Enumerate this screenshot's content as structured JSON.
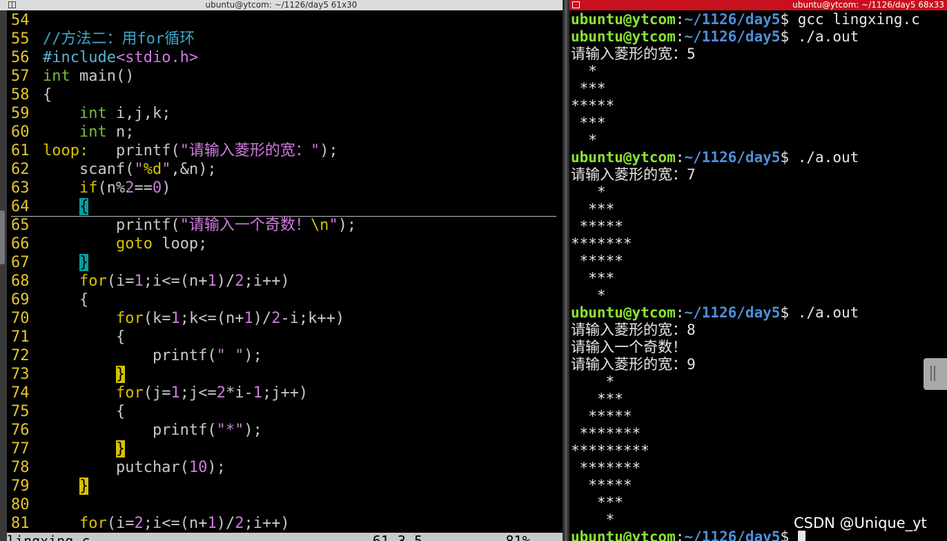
{
  "left_window": {
    "title": "ubuntu@ytcom: ~/1126/day5 61x30",
    "lines": [
      {
        "n": "54",
        "segs": []
      },
      {
        "n": "55",
        "segs": [
          {
            "t": "//方法二：用for循环",
            "c": "c-cmt"
          }
        ]
      },
      {
        "n": "56",
        "segs": [
          {
            "t": "#include",
            "c": "c-pp"
          },
          {
            "t": "<stdio.h>",
            "c": "c-str"
          }
        ]
      },
      {
        "n": "57",
        "segs": [
          {
            "t": "int",
            "c": "c-type"
          },
          {
            "t": " main()",
            "c": "c-op"
          }
        ]
      },
      {
        "n": "58",
        "segs": [
          {
            "t": "{",
            "c": "c-op"
          }
        ]
      },
      {
        "n": "59",
        "segs": [
          {
            "t": "    "
          },
          {
            "t": "int",
            "c": "c-type"
          },
          {
            "t": " i,j,k;",
            "c": "c-op"
          }
        ]
      },
      {
        "n": "60",
        "segs": [
          {
            "t": "    "
          },
          {
            "t": "int",
            "c": "c-type"
          },
          {
            "t": " n;",
            "c": "c-op"
          }
        ]
      },
      {
        "n": "61",
        "segs": [
          {
            "t": "loop:",
            "c": "c-kw"
          },
          {
            "t": "   printf(",
            "c": "c-op"
          },
          {
            "t": "\"请输入菱形的宽：\"",
            "c": "c-str"
          },
          {
            "t": ");",
            "c": "c-op"
          }
        ]
      },
      {
        "n": "62",
        "segs": [
          {
            "t": "    scanf(",
            "c": "c-op"
          },
          {
            "t": "\"",
            "c": "c-str"
          },
          {
            "t": "%d",
            "c": "c-kw"
          },
          {
            "t": "\"",
            "c": "c-str"
          },
          {
            "t": ",&n);",
            "c": "c-op"
          }
        ]
      },
      {
        "n": "63",
        "segs": [
          {
            "t": "    "
          },
          {
            "t": "if",
            "c": "c-kw"
          },
          {
            "t": "(n%",
            "c": "c-op"
          },
          {
            "t": "2",
            "c": "c-num"
          },
          {
            "t": "==",
            "c": "c-op"
          },
          {
            "t": "0",
            "c": "c-num"
          },
          {
            "t": ")",
            "c": "c-op"
          }
        ]
      },
      {
        "n": "64",
        "segs": [
          {
            "t": "    "
          },
          {
            "t": "{",
            "c": "hl-cyan"
          }
        ],
        "cursorline": true
      },
      {
        "n": "65",
        "segs": [
          {
            "t": "        printf(",
            "c": "c-op"
          },
          {
            "t": "\"请输入一个奇数！",
            "c": "c-str"
          },
          {
            "t": "\\n",
            "c": "c-kw"
          },
          {
            "t": "\"",
            "c": "c-str"
          },
          {
            "t": ");",
            "c": "c-op"
          }
        ]
      },
      {
        "n": "66",
        "segs": [
          {
            "t": "        "
          },
          {
            "t": "goto",
            "c": "c-kw"
          },
          {
            "t": " loop;",
            "c": "c-op"
          }
        ]
      },
      {
        "n": "67",
        "segs": [
          {
            "t": "    "
          },
          {
            "t": "}",
            "c": "hl-cyan"
          }
        ]
      },
      {
        "n": "68",
        "segs": [
          {
            "t": "    "
          },
          {
            "t": "for",
            "c": "c-kw"
          },
          {
            "t": "(i=",
            "c": "c-op"
          },
          {
            "t": "1",
            "c": "c-num"
          },
          {
            "t": ";i<=(n+",
            "c": "c-op"
          },
          {
            "t": "1",
            "c": "c-num"
          },
          {
            "t": ")/",
            "c": "c-op"
          },
          {
            "t": "2",
            "c": "c-num"
          },
          {
            "t": ";i++)",
            "c": "c-op"
          }
        ]
      },
      {
        "n": "69",
        "segs": [
          {
            "t": "    {",
            "c": "c-op"
          }
        ]
      },
      {
        "n": "70",
        "segs": [
          {
            "t": "        "
          },
          {
            "t": "for",
            "c": "c-kw"
          },
          {
            "t": "(k=",
            "c": "c-op"
          },
          {
            "t": "1",
            "c": "c-num"
          },
          {
            "t": ";k<=(n+",
            "c": "c-op"
          },
          {
            "t": "1",
            "c": "c-num"
          },
          {
            "t": ")/",
            "c": "c-op"
          },
          {
            "t": "2",
            "c": "c-num"
          },
          {
            "t": "-i;k++)",
            "c": "c-op"
          }
        ]
      },
      {
        "n": "71",
        "segs": [
          {
            "t": "        {",
            "c": "c-op"
          }
        ]
      },
      {
        "n": "72",
        "segs": [
          {
            "t": "            printf(",
            "c": "c-op"
          },
          {
            "t": "\" \"",
            "c": "c-str"
          },
          {
            "t": ");",
            "c": "c-op"
          }
        ]
      },
      {
        "n": "73",
        "segs": [
          {
            "t": "        "
          },
          {
            "t": "}",
            "c": "hl-yel"
          }
        ]
      },
      {
        "n": "74",
        "segs": [
          {
            "t": "        "
          },
          {
            "t": "for",
            "c": "c-kw"
          },
          {
            "t": "(j=",
            "c": "c-op"
          },
          {
            "t": "1",
            "c": "c-num"
          },
          {
            "t": ";j<=",
            "c": "c-op"
          },
          {
            "t": "2",
            "c": "c-num"
          },
          {
            "t": "*i-",
            "c": "c-op"
          },
          {
            "t": "1",
            "c": "c-num"
          },
          {
            "t": ";j++)",
            "c": "c-op"
          }
        ]
      },
      {
        "n": "75",
        "segs": [
          {
            "t": "        {",
            "c": "c-op"
          }
        ]
      },
      {
        "n": "76",
        "segs": [
          {
            "t": "            printf(",
            "c": "c-op"
          },
          {
            "t": "\"*\"",
            "c": "c-str"
          },
          {
            "t": ");",
            "c": "c-op"
          }
        ]
      },
      {
        "n": "77",
        "segs": [
          {
            "t": "        "
          },
          {
            "t": "}",
            "c": "hl-yel"
          }
        ]
      },
      {
        "n": "78",
        "segs": [
          {
            "t": "        putchar(",
            "c": "c-op"
          },
          {
            "t": "10",
            "c": "c-num"
          },
          {
            "t": ");",
            "c": "c-op"
          }
        ]
      },
      {
        "n": "79",
        "segs": [
          {
            "t": "    "
          },
          {
            "t": "}",
            "c": "hl-yel"
          }
        ]
      },
      {
        "n": "80",
        "segs": []
      },
      {
        "n": "81",
        "segs": [
          {
            "t": "    "
          },
          {
            "t": "for",
            "c": "c-kw"
          },
          {
            "t": "(i=",
            "c": "c-op"
          },
          {
            "t": "2",
            "c": "c-num"
          },
          {
            "t": ";i<=(n+",
            "c": "c-op"
          },
          {
            "t": "1",
            "c": "c-num"
          },
          {
            "t": ")/",
            "c": "c-op"
          },
          {
            "t": "2",
            "c": "c-num"
          },
          {
            "t": ";i++)",
            "c": "c-op"
          }
        ]
      }
    ],
    "status": "lingxing.c                                  61,3-5          81%"
  },
  "right_window": {
    "title": "ubuntu@ytcom: ~/1126/day5 68x33",
    "prompt_user": "ubuntu@ytcom",
    "prompt_sep": ":",
    "prompt_path": "~/1126/day5",
    "prompt_end": "$ ",
    "lines": [
      {
        "prompt": true,
        "cmd": "gcc lingxing.c"
      },
      {
        "prompt": true,
        "cmd": "./a.out"
      },
      {
        "text": "请输入菱形的宽：5"
      },
      {
        "text": "  *"
      },
      {
        "text": " ***"
      },
      {
        "text": "*****"
      },
      {
        "text": " ***"
      },
      {
        "text": "  *"
      },
      {
        "prompt": true,
        "cmd": "./a.out"
      },
      {
        "text": "请输入菱形的宽：7"
      },
      {
        "text": "   *"
      },
      {
        "text": "  ***"
      },
      {
        "text": " *****"
      },
      {
        "text": "*******"
      },
      {
        "text": " *****"
      },
      {
        "text": "  ***"
      },
      {
        "text": "   *"
      },
      {
        "prompt": true,
        "cmd": "./a.out"
      },
      {
        "text": "请输入菱形的宽：8"
      },
      {
        "text": "请输入一个奇数！"
      },
      {
        "text": "请输入菱形的宽：9"
      },
      {
        "text": "    *"
      },
      {
        "text": "   ***"
      },
      {
        "text": "  *****"
      },
      {
        "text": " *******"
      },
      {
        "text": "*********"
      },
      {
        "text": " *******"
      },
      {
        "text": "  *****"
      },
      {
        "text": "   ***"
      },
      {
        "text": "    *"
      },
      {
        "prompt": true,
        "cmd": "",
        "cursor": true
      }
    ]
  },
  "watermark": "CSDN @Unique_yt",
  "colors": {
    "right_titlebar": "#c9101e",
    "prompt_user": "#8ae234",
    "prompt_path": "#4f8fd8",
    "line_numbers": "#e5c62e"
  }
}
